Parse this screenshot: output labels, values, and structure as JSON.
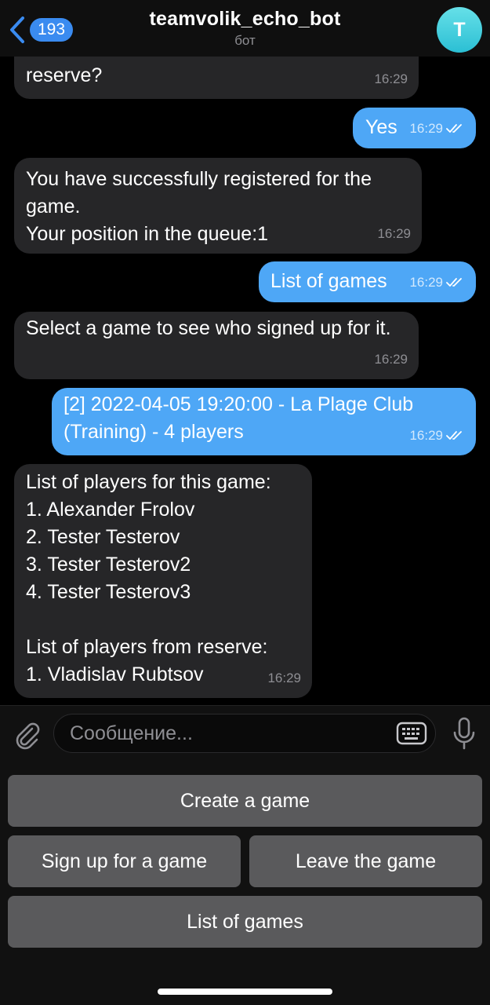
{
  "header": {
    "back_count": "193",
    "title": "teamvolik_echo_bot",
    "subtitle": "бот",
    "avatar_letter": "T"
  },
  "messages": [
    {
      "dir": "in",
      "text": "reserve?",
      "time": "16:29"
    },
    {
      "dir": "out",
      "text": "Yes",
      "time": "16:29",
      "read": true
    },
    {
      "dir": "in",
      "text": "You have successfully registered for the game.\nYour position in the queue:1",
      "time": "16:29"
    },
    {
      "dir": "out",
      "text": "List of games",
      "time": "16:29",
      "read": true
    },
    {
      "dir": "in",
      "text": "Select a game to see who signed up for it.",
      "time": "16:29"
    },
    {
      "dir": "out",
      "text": "[2] 2022-04-05 19:20:00 - La Plage Club (Training) - 4 players",
      "time": "16:29",
      "read": true
    },
    {
      "dir": "in",
      "text": "List of players for this game:\n1. Alexander Frolov\n2. Tester Testerov\n3. Tester Testerov2\n4. Tester Testerov3\n\nList of players from reserve:\n1. Vladislav Rubtsov",
      "time": "16:29"
    }
  ],
  "composer": {
    "placeholder": "Сообщение..."
  },
  "keyboard": {
    "create": "Create a game",
    "sign_up": "Sign up for a game",
    "leave": "Leave the game",
    "list": "List of games"
  },
  "colors": {
    "outgoing_bubble": "#4ea7f6",
    "incoming_bubble": "#262628",
    "accent": "#3a8bf0",
    "avatar": "#2bbfd4"
  }
}
